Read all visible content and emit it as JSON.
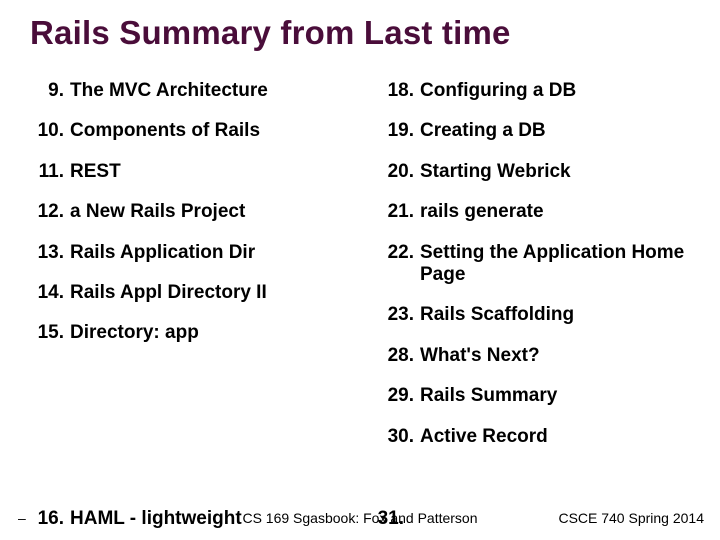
{
  "title": "Rails Summary from Last time",
  "left": [
    {
      "n": "9.",
      "t": "The MVC Architecture"
    },
    {
      "n": "10.",
      "t": "Components of Rails"
    },
    {
      "n": "11.",
      "t": "REST"
    },
    {
      "n": "12.",
      "t": "a New Rails Project"
    },
    {
      "n": "13.",
      "t": "Rails Application Dir"
    },
    {
      "n": "14.",
      "t": "Rails Appl Directory II"
    },
    {
      "n": "15.",
      "t": "Directory: app"
    }
  ],
  "right": [
    {
      "n": "18.",
      "t": "Configuring a DB"
    },
    {
      "n": "19.",
      "t": "Creating a DB"
    },
    {
      "n": "20.",
      "t": "Starting Webrick"
    },
    {
      "n": "21.",
      "t": "rails generate"
    },
    {
      "n": "22.",
      "t": "Setting the Application Home Page"
    },
    {
      "n": "23.",
      "t": "Rails Scaffolding"
    },
    {
      "n": "28.",
      "t": "What's Next?"
    },
    {
      "n": "29.",
      "t": "Rails Summary"
    },
    {
      "n": "30.",
      "t": "Active Record"
    }
  ],
  "overlap_left": {
    "n": "16.",
    "t": "HAML - lightweight"
  },
  "overlap_right": {
    "n": "31.",
    "t": ""
  },
  "footer": {
    "dash": "–",
    "center": "CS 169 Sgasbook: Fox and Patterson",
    "right": "CSCE 740 Spring 2014"
  }
}
